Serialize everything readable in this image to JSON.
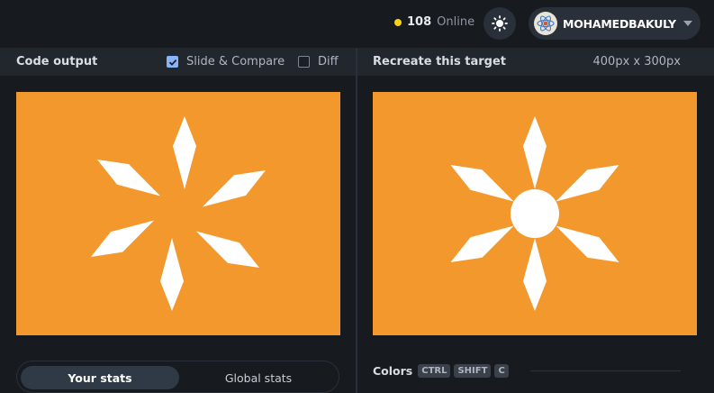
{
  "header": {
    "online_count": "108",
    "online_label": "Online",
    "username": "MOHAMEDBAKULY",
    "theme_icon": "sun-icon",
    "chevron_icon": "chevron-down-icon"
  },
  "left_panel": {
    "title": "Code output",
    "slide_compare_label": "Slide & Compare",
    "slide_compare_checked": true,
    "diff_label": "Diff",
    "diff_checked": false,
    "canvas_bg": "#f3982d",
    "shape_color": "#ffffff"
  },
  "right_panel": {
    "title": "Recreate this target",
    "dimensions": "400px x 300px",
    "canvas_bg": "#f3982d",
    "shape_color": "#ffffff"
  },
  "stats_tabs": {
    "your_stats": "Your stats",
    "global_stats": "Global stats",
    "active": "your_stats"
  },
  "colors_section": {
    "title": "Colors",
    "keys": [
      "CTRL",
      "SHIFT",
      "C"
    ]
  },
  "colors": {
    "accent": "#8ab4f8",
    "online_dot": "#f2d21b",
    "background": "#171a1f",
    "panel_header": "#22272e"
  }
}
